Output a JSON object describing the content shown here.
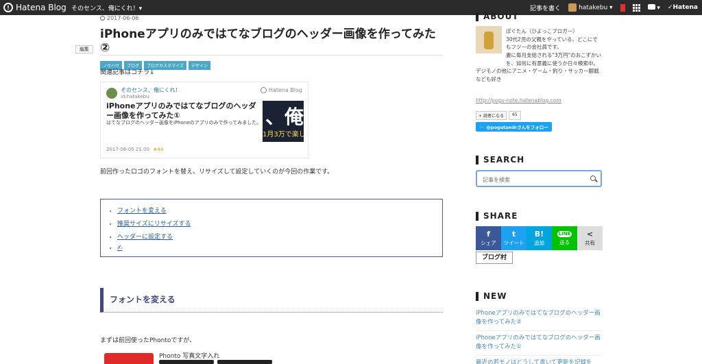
{
  "topbar": {
    "logo_text": "Hatena Blog",
    "blog_name": "そのセンス、俺にくれ！▾",
    "write_label": "記事を書く",
    "username": "hatakebu ▾",
    "hatena_label": "Hatena"
  },
  "article": {
    "date": "2017-06-06",
    "title": "iPhoneアプリのみではてなブログのヘッダー画像を作ってみた②",
    "edit_label": "編集",
    "tags": [
      "ノウハウ",
      "ブログ",
      "ブログカスタマイズ",
      "デザイン"
    ],
    "related_intro": "関連記事はコチラ↓",
    "intro_text": "前回作ったロゴのフォントを替え、リサイズして設定していくのが今回の作業です。",
    "toc": [
      "フォントを変える",
      "推奨サイズにリサイズする",
      "ヘッダーに設定する",
      "✍"
    ],
    "section_heading": "フォントを変える",
    "section_text": "まずは前回使ったPhontoですが、",
    "phonto_name": "Phonto 写真文字入れ"
  },
  "card": {
    "blog_name": "そのセンス、俺にくれ！",
    "blog_id": "id:hatakebu",
    "service": "Hatena Blog",
    "title": "iPhoneアプリのみではてなブログのヘッダー画像を作ってみた①",
    "description": "はてなブログのヘッダー画像をiPhoneのアプリのみで作ってみました。",
    "meta": "2017-06-05 21:00",
    "stars": "★44",
    "thumb_big": "、俺",
    "thumb_small": "1月3万で楽し"
  },
  "sidebar": {
    "about_heading": "ABOUT",
    "about_line1": "ぽぐたん（ひよっこブロガー）",
    "about_line2": "30代2児の父親をやっている、どこにでもフツーの会社員です。",
    "about_line3": "妻に毎月支給される\"3万円\"のおこずかいを、如何に有意義に使うか日々模索中。",
    "about_line4": "デジモノの他にアニメ・ゲーム・釣り・サッカー観戦なども好き",
    "about_link": "http://pogu-note.hatenablog.com",
    "reader_label": "読者になる",
    "reader_count": "65",
    "twitter_follow": "@pogutandrさんをフォロー",
    "search_heading": "SEARCH",
    "search_placeholder": "記事を検索",
    "share_heading": "SHARE",
    "share_buttons": [
      {
        "icon": "f",
        "label": "シェア"
      },
      {
        "icon": "t",
        "label": "ツイート"
      },
      {
        "icon": "B!",
        "label": "追加"
      },
      {
        "icon": "LINE",
        "label": "送る"
      },
      {
        "icon": "<",
        "label": "共有"
      }
    ],
    "blogmura": "ブログ村",
    "new_heading": "NEW",
    "new_items": [
      "iPhoneアプリのみではてなブログのヘッダー画像を作ってみた②",
      "iPhoneアプリのみではてなブログのヘッダー画像を作ってみた①",
      "最近の若モノはどうして書いて更新を記録を"
    ]
  },
  "colors": {
    "topbar": "#2b2b2b",
    "tag": "#4aa7c9",
    "heading_accent": "#3e4a7e",
    "link": "#2a5f99",
    "facebook": "#3b5998",
    "twitter": "#1da1f2",
    "hatena_bookmark": "#00a4de",
    "line": "#00c300",
    "share_other": "#dddddd"
  }
}
